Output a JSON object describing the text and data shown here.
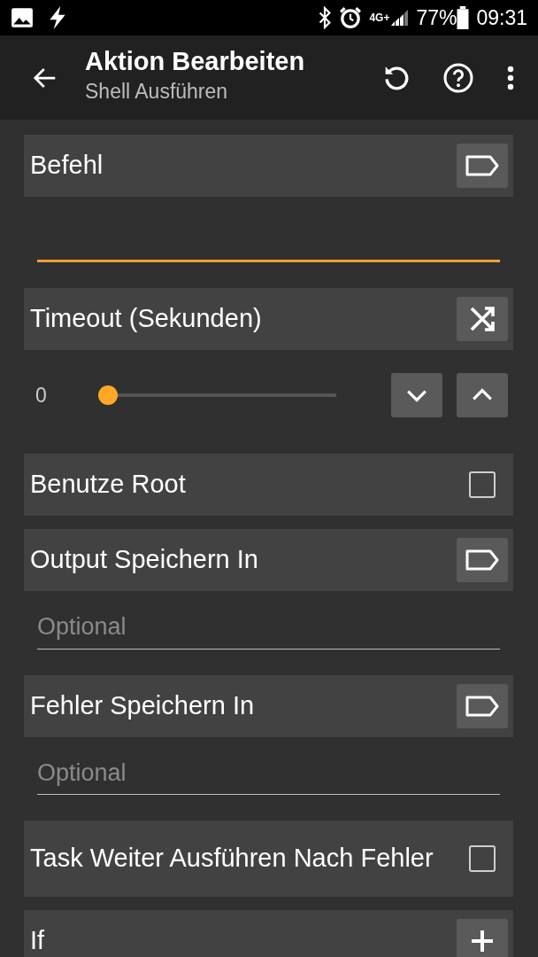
{
  "status_bar": {
    "network": "4G+",
    "battery": "77%",
    "time": "09:31"
  },
  "toolbar": {
    "title": "Aktion Bearbeiten",
    "subtitle": "Shell Ausführen"
  },
  "params": [
    {
      "kind": "text",
      "label": "Befehl",
      "focused": true
    },
    {
      "kind": "slider",
      "label": "Timeout (Sekunden)",
      "reading": "0",
      "level": 0
    },
    {
      "kind": "checkbox",
      "label": "Benutze Root",
      "checked": false
    },
    {
      "kind": "text",
      "label": "Output Speichern In",
      "placeholder": "Optional",
      "focused": false
    },
    {
      "kind": "text",
      "label": "Fehler Speichern In",
      "placeholder": "Optional",
      "focused": false
    },
    {
      "kind": "checkbox",
      "label": "Task Weiter Ausführen Nach Fehler",
      "checked": false
    },
    {
      "kind": "add",
      "label": "If"
    }
  ]
}
